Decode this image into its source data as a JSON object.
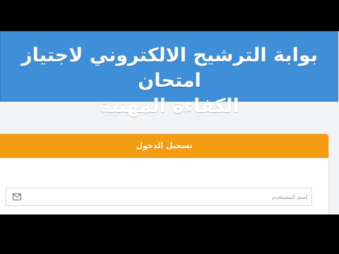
{
  "header": {
    "title_line1": "بوابة الترشيح الالكتروني لاجتياز امتحان",
    "title_line2": "الكفاءة المهنية"
  },
  "login": {
    "heading": "تسجيل الدخول",
    "username_placeholder": "إسم المستخدم",
    "username_value": "",
    "username_icon": "envelope-icon"
  },
  "colors": {
    "header_bg": "#3f8fd8",
    "card_header_bg": "#f39c12",
    "page_bg": "#f2f3f5"
  }
}
